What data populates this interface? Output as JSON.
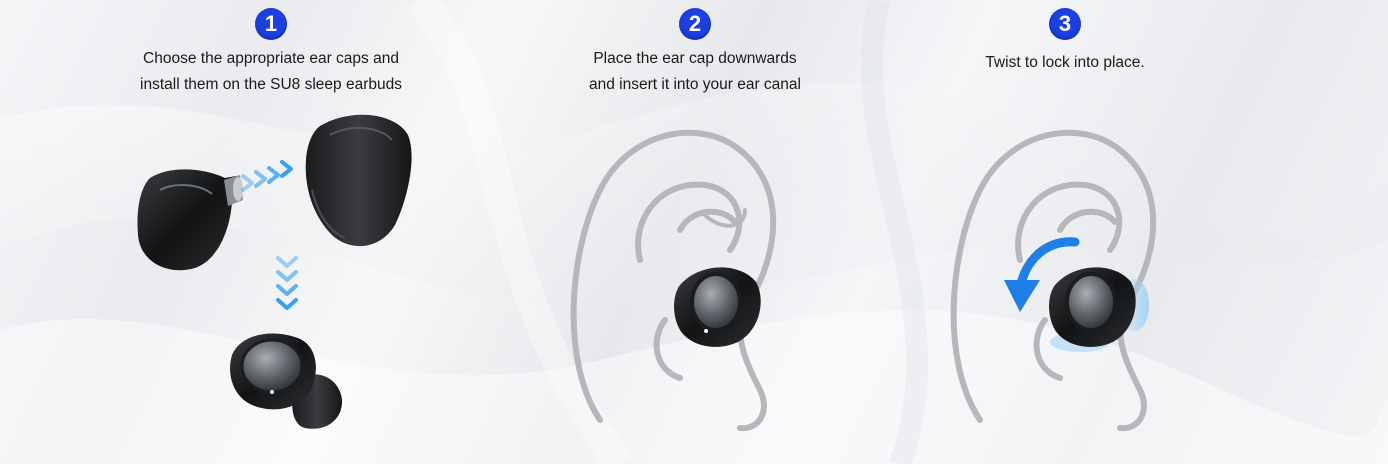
{
  "steps": [
    {
      "number": "1",
      "lines": [
        "Choose the appropriate ear caps and",
        "install them on the SU8 sleep earbuds"
      ]
    },
    {
      "number": "2",
      "lines": [
        "Place the ear cap downwards",
        "and insert it into your ear canal"
      ]
    },
    {
      "number": "3",
      "lines": [
        "Twist to lock into place."
      ]
    }
  ],
  "colors": {
    "badge": "#1b3fe0",
    "arrow": "#3aa0f0",
    "rotate_arrow": "#1e7fe6"
  },
  "icons": [
    "earbud-body-icon",
    "ear-cap-icon",
    "right-chevrons-icon",
    "down-chevrons-icon",
    "assembled-earbud-icon",
    "ear-outline-icon",
    "rotate-arrow-icon"
  ]
}
